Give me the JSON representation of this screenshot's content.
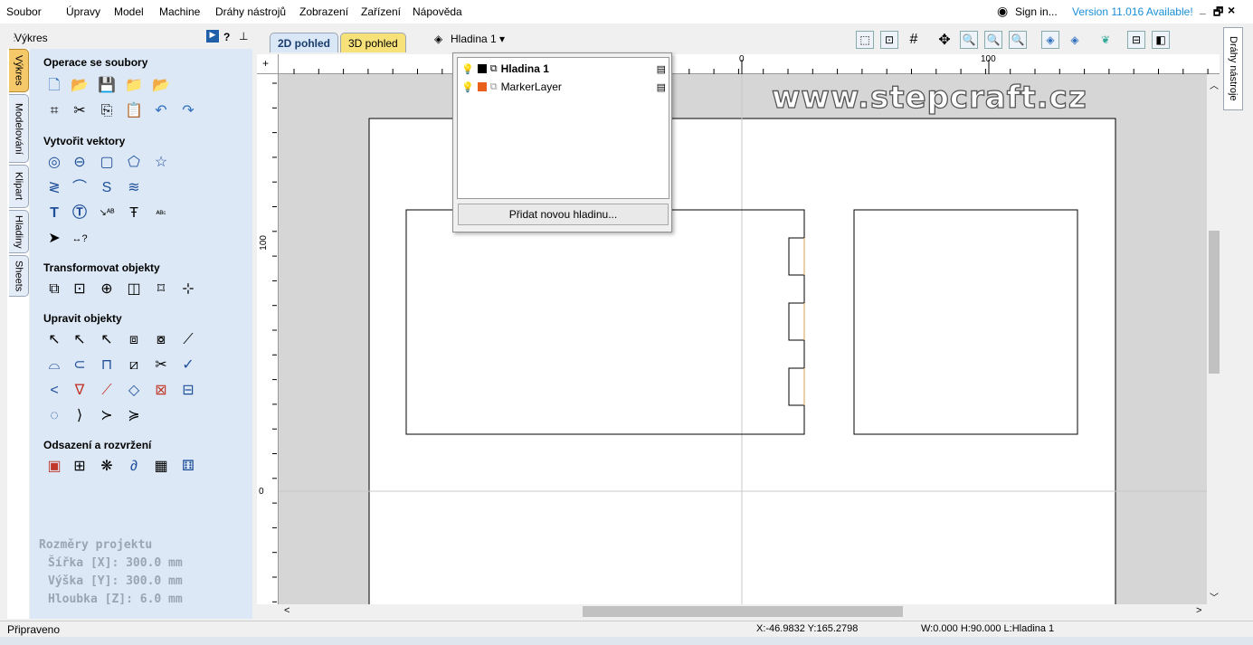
{
  "menu": [
    "Soubor",
    "Úpravy",
    "Model",
    "Machine",
    "Dráhy nástrojů",
    "Zobrazení",
    "Zařízení",
    "Nápověda"
  ],
  "account": {
    "signin": "Sign in...",
    "version": "Version 11.016 Available!"
  },
  "window_controls": {
    "min": "_",
    "restore": "🗗",
    "close": "×"
  },
  "panel": {
    "title": "Výkres",
    "help": "?",
    "pin": "⊥"
  },
  "side_tabs": [
    "Výkres",
    "Modelování",
    "Klipart",
    "Hladiny",
    "Sheets"
  ],
  "sections": {
    "files": "Operace se soubory",
    "vectors": "Vytvořit vektory",
    "transform": "Transformovat objekty",
    "edit": "Upravit objekty",
    "offset": "Odsazení a rozvržení"
  },
  "project": {
    "heading": "Rozměry projektu",
    "width": "Šířka  [X]: 300.0 mm",
    "height": "Výška  [Y]: 300.0 mm",
    "depth": "Hloubka [Z]: 6.0 mm"
  },
  "view_tabs": {
    "tab2d": "2D pohled",
    "tab3d": "3D pohled"
  },
  "layer_button": "Hladina 1 ▾",
  "layers": [
    {
      "name": "Hladina 1",
      "color": "#000000",
      "bold": true
    },
    {
      "name": "MarkerLayer",
      "color": "#e8601c",
      "bold": false
    }
  ],
  "add_layer": "Přidat novou hladinu...",
  "watermark": "www.stepcraft.cz",
  "ruler": {
    "top_labels": [
      "0",
      "100"
    ],
    "left_labels": [
      "100",
      "0"
    ]
  },
  "right_tab": "Dráhy nástroje",
  "status": {
    "left": "Připraveno",
    "coords": "X:-46.9832 Y:165.2798",
    "dims": "W:0.000  H:90.000  L:Hladina 1"
  },
  "colors": {
    "panel": "#dce8f5",
    "active_tab": "#f5c86a",
    "accent_link": "#1a8fd6",
    "canvas_bg": "#d6d6d6"
  }
}
